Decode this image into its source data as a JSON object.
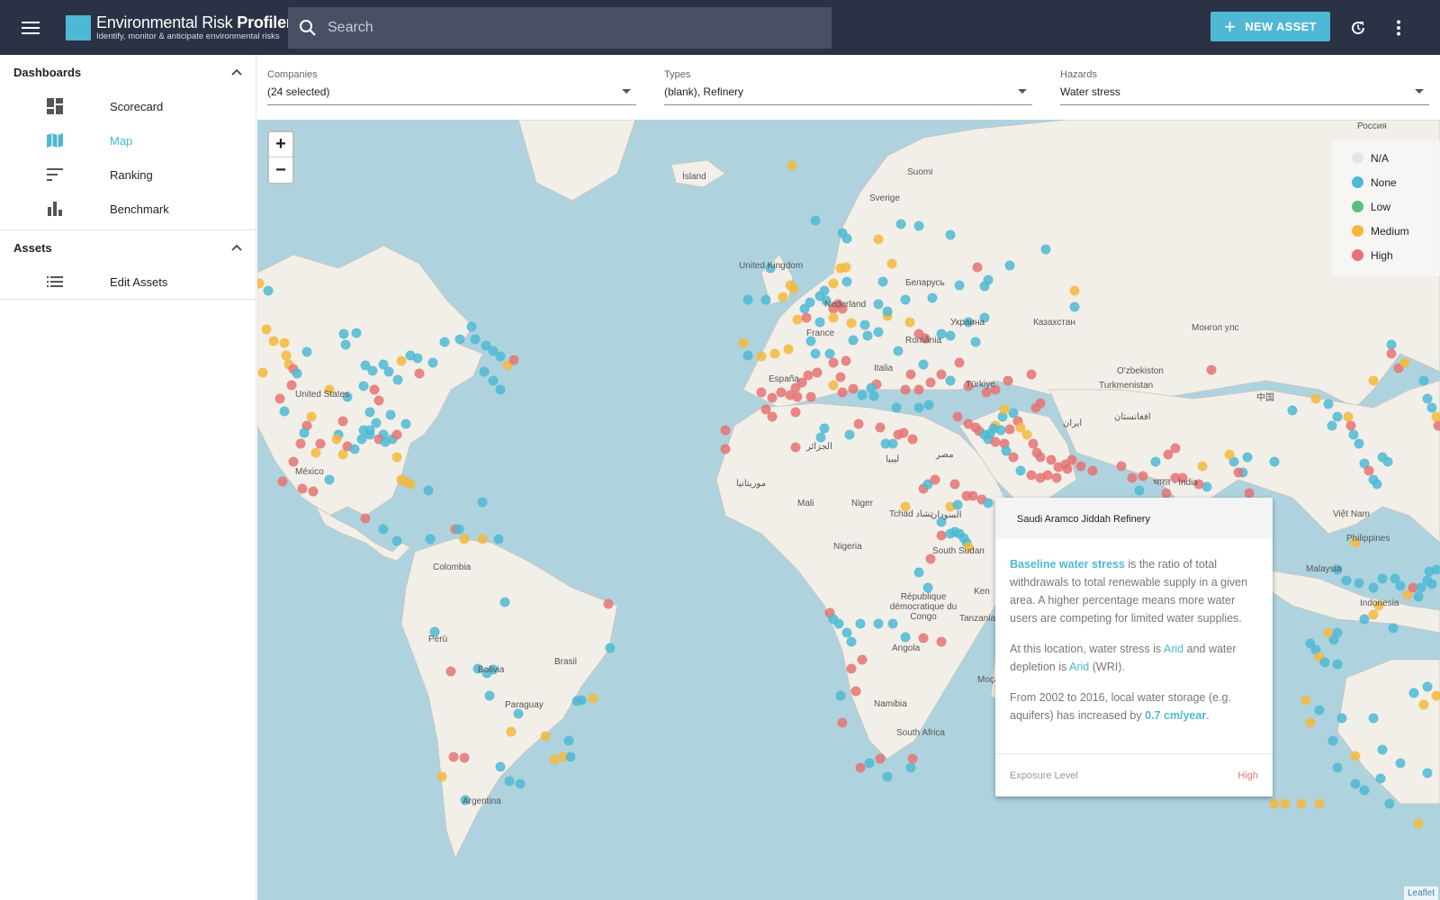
{
  "app": {
    "title_regular": "Environmental Risk ",
    "title_bold": "Profiler",
    "subtitle": "Identify, monitor & anticipate environmental risks",
    "brand_color": "#4fb8d4"
  },
  "search": {
    "placeholder": "Search"
  },
  "toolbar": {
    "new_asset_label": "NEW ASSET"
  },
  "sidebar": {
    "dashboards_header": "Dashboards",
    "dashboard_items": [
      {
        "label": "Scorecard",
        "icon": "dashboard-icon"
      },
      {
        "label": "Map",
        "icon": "map-icon",
        "active": true
      },
      {
        "label": "Ranking",
        "icon": "sort-icon"
      },
      {
        "label": "Benchmark",
        "icon": "bar-chart-icon"
      }
    ],
    "assets_header": "Assets",
    "asset_items": [
      {
        "label": "Edit Assets",
        "icon": "list-icon"
      }
    ]
  },
  "filters": {
    "companies": {
      "label": "Companies",
      "value": "(24 selected)"
    },
    "types": {
      "label": "Types",
      "value": "(blank), Refinery"
    },
    "hazards": {
      "label": "Hazards",
      "value": "Water stress"
    }
  },
  "map": {
    "legend": [
      {
        "label": "N/A",
        "color": "#e6e6e6"
      },
      {
        "label": "None",
        "color": "#4fb8d4"
      },
      {
        "label": "Low",
        "color": "#5cc07a"
      },
      {
        "label": "Medium",
        "color": "#f5b83d"
      },
      {
        "label": "High",
        "color": "#e57373"
      }
    ],
    "labels": [
      "Россия",
      "Ísland",
      "Suomi",
      "Sverige",
      "United Kingdom",
      "Беларусь",
      "Украина",
      "Nederland",
      "France",
      "España",
      "România",
      "Italia",
      "Türkiye",
      "Казахстан",
      "O'zbekiston",
      "Turkmenistan",
      "Монгол улс",
      "中国",
      "افغانستان",
      "ایران",
      "الجزائر",
      "ليبيا",
      "مصر",
      "Mali",
      "Niger",
      "Tchad تشاد",
      "السودان",
      "Nigeria",
      "South Sudan",
      "République démocratique du Congo",
      "Angola",
      "Namibia",
      "South Africa",
      "Tanzania",
      "Moçambique",
      "United States",
      "México",
      "Colombia",
      "Perú",
      "Brasil",
      "Bolivia",
      "Paraguay",
      "Argentina",
      "भारत - India",
      "Việt Nam",
      "Philippines",
      "Malaysia",
      "Indonesia",
      "موريتانيا",
      "Ken"
    ],
    "attribution": "Leaflet",
    "zoom_in": "+",
    "zoom_out": "−"
  },
  "popup": {
    "title": "Saudi Aramco Jiddah Refinery",
    "p1_link": "Baseline water stress",
    "p1_text": " is the ratio of total withdrawals to total renewable supply in a given area. A higher percentage means more water users are competing for limited water supplies.",
    "p2_a": "At this location, water stress is ",
    "p2_v1": "Arid",
    "p2_b": " and water depletion is ",
    "p2_v2": "Arid",
    "p2_c": " (WRI).",
    "p3_a": "From 2002 to 2016, local water storage (e.g. aquifers) has increased by ",
    "p3_v": "0.7 cm/year",
    "p3_b": ".",
    "exposure_label": "Exposure Level",
    "exposure_value": "High"
  }
}
